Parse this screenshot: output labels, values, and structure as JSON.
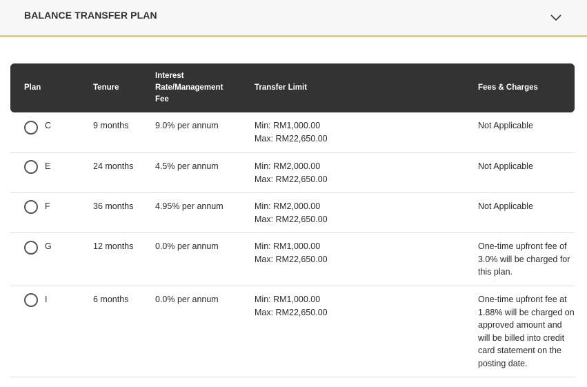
{
  "accordion": {
    "title": "BALANCE TRANSFER PLAN",
    "chevron_icon": "chevron-down-icon"
  },
  "table": {
    "headers": {
      "plan": "Plan",
      "tenure": "Tenure",
      "rate_line1": "Interest",
      "rate_line2": "Rate/Management",
      "rate_line3": "Fee",
      "limit": "Transfer Limit",
      "fees": "Fees & Charges"
    },
    "rows": [
      {
        "plan": "C",
        "tenure": "9 months",
        "rate": "9.0% per annum",
        "min": "Min: RM1,000.00",
        "max": "Max: RM22,650.00",
        "fees": "Not Applicable"
      },
      {
        "plan": "E",
        "tenure": "24 months",
        "rate": "4.5% per annum",
        "min": "Min: RM2,000.00",
        "max": "Max: RM22,650.00",
        "fees": "Not Applicable"
      },
      {
        "plan": "F",
        "tenure": "36 months",
        "rate": "4.95% per annum",
        "min": "Min: RM2,000.00",
        "max": "Max: RM22,650.00",
        "fees": "Not Applicable"
      },
      {
        "plan": "G",
        "tenure": "12 months",
        "rate": "0.0% per annum",
        "min": "Min: RM1,000.00",
        "max": "Max: RM22,650.00",
        "fees": "One-time upfront fee of 3.0% will be charged for this plan."
      },
      {
        "plan": "I",
        "tenure": "6 months",
        "rate": "0.0% per annum",
        "min": "Min: RM1,000.00",
        "max": "Max: RM22,650.00",
        "fees": "One-time upfront fee at 1.88% will be charged on approved amount and will be billed into credit card statement on the posting date."
      }
    ]
  }
}
